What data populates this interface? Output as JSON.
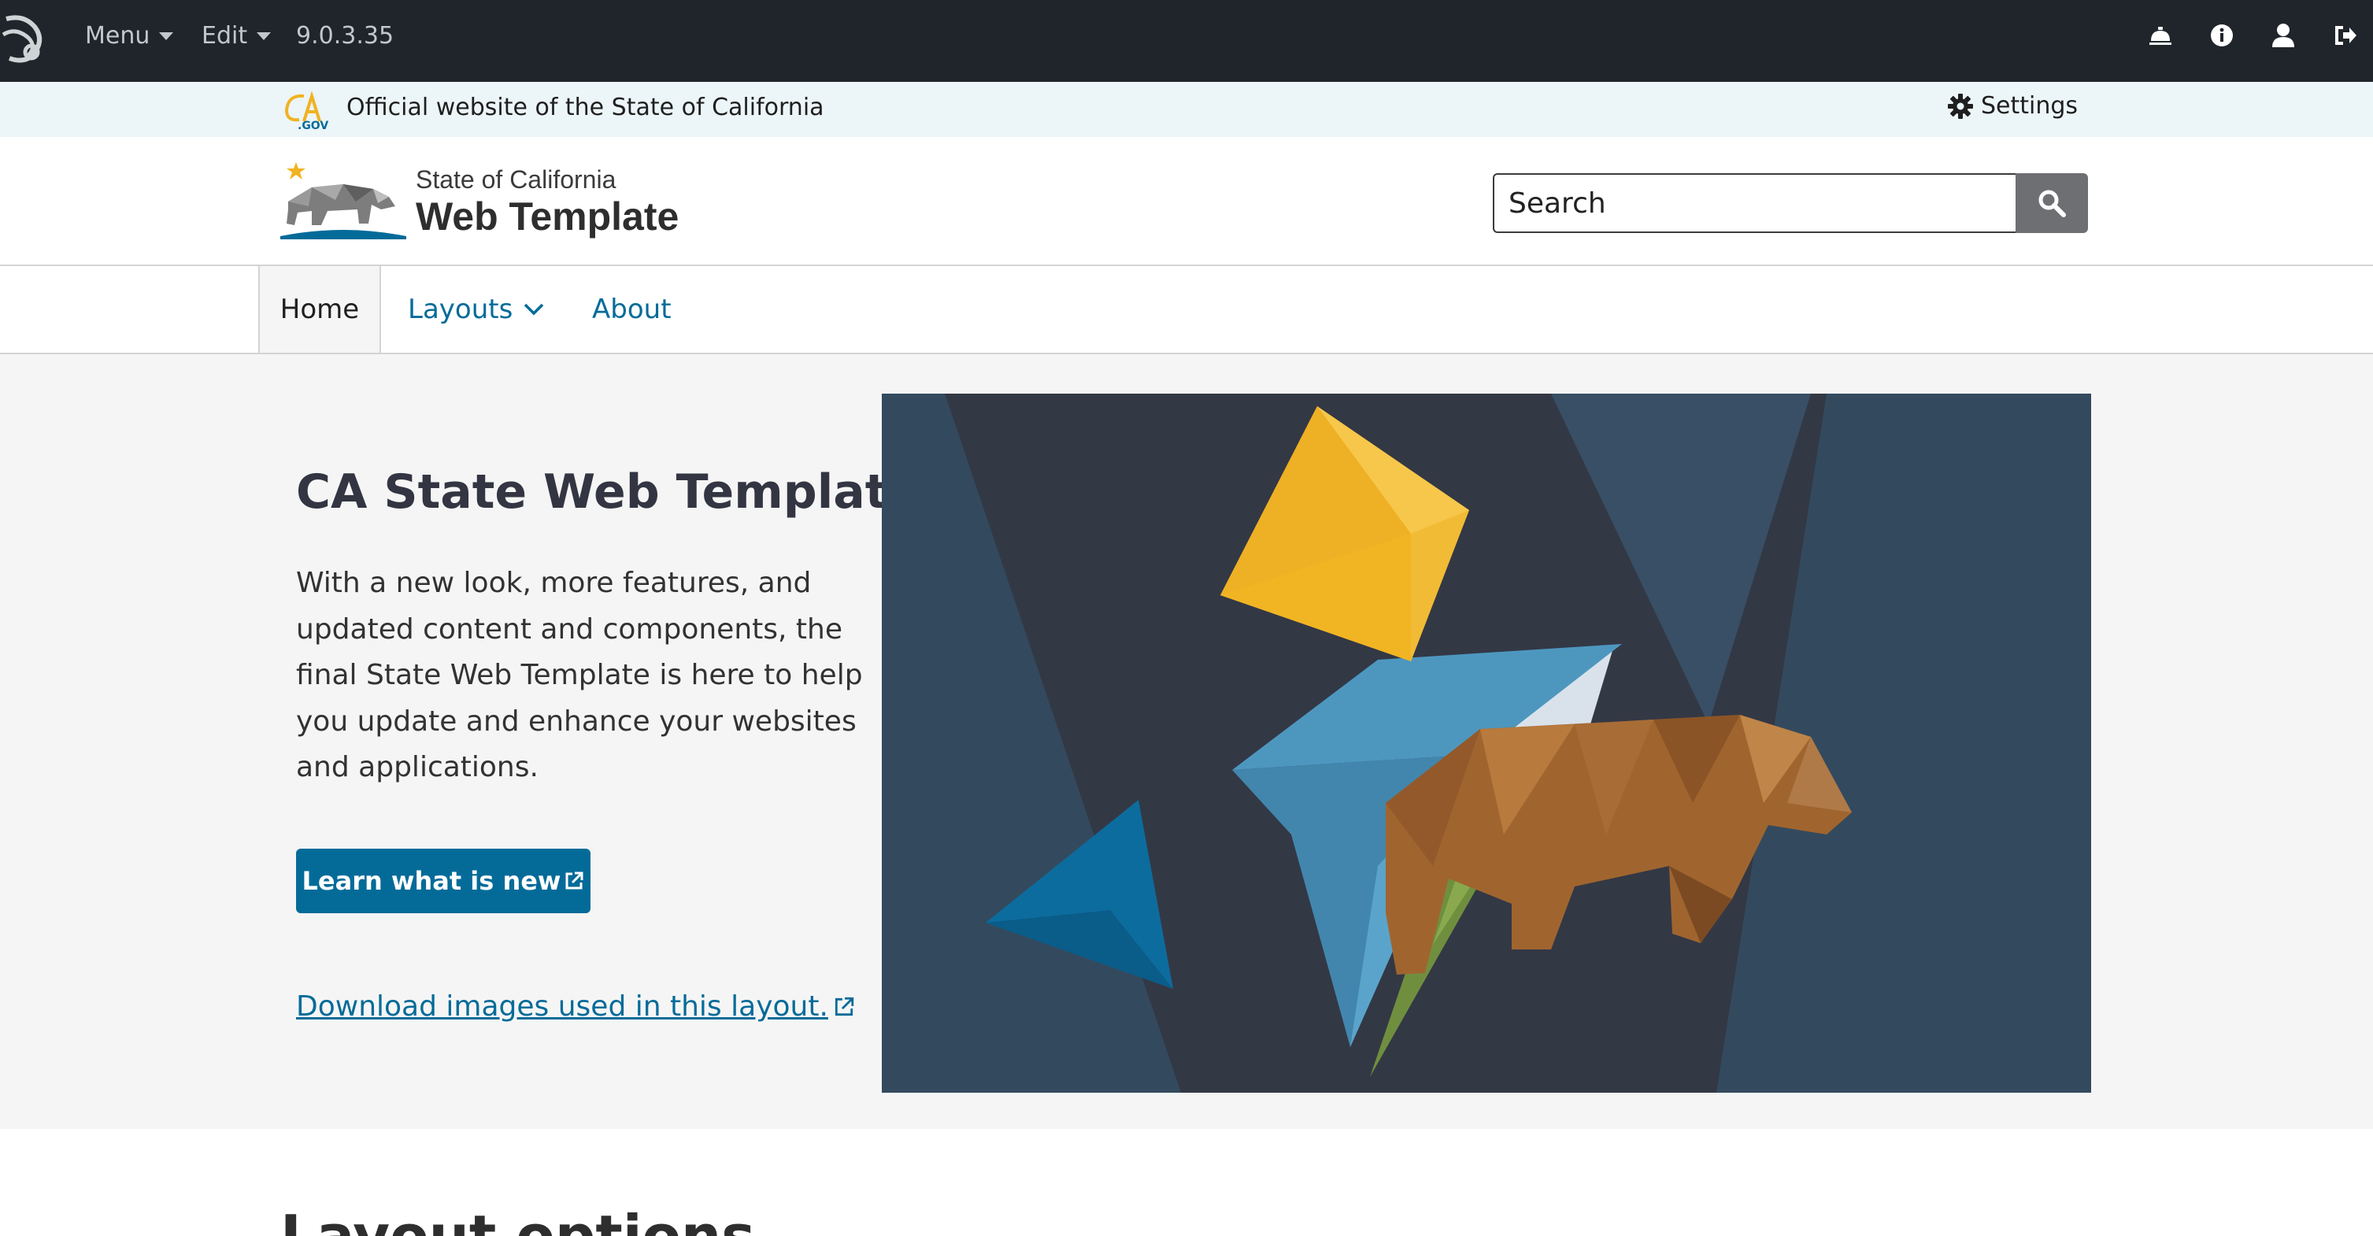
{
  "admin_bar": {
    "menu_label": "Menu",
    "edit_label": "Edit",
    "version": "9.0.3.35",
    "icons": [
      "drupal-logo-icon",
      "concierge-bell-icon",
      "info-circle-icon",
      "user-icon",
      "sign-out-icon"
    ]
  },
  "utility": {
    "official_text": "Official website of the State of California",
    "settings_label": "Settings"
  },
  "branding": {
    "state": "State of California",
    "title": "Web Template"
  },
  "search": {
    "placeholder": "Search"
  },
  "nav": {
    "home": "Home",
    "layouts": "Layouts",
    "about": "About"
  },
  "hero": {
    "title": "CA State Web Template",
    "body": "With a new look, more features, and updated content and components, the final State Web Template is here to help you update and enhance your websites and applications.",
    "button_label": "Learn what is new",
    "download_link": "Download images used in this layout."
  },
  "next_section": {
    "heading": "Layout options"
  },
  "colors": {
    "admin_bg": "#20252b",
    "utility_bg": "#ecf5f8",
    "link": "#046b99",
    "hero_bg": "#f5f5f5",
    "art_bg": "#334a5e",
    "gem": "#f3b622",
    "bear": "#a0652f"
  }
}
